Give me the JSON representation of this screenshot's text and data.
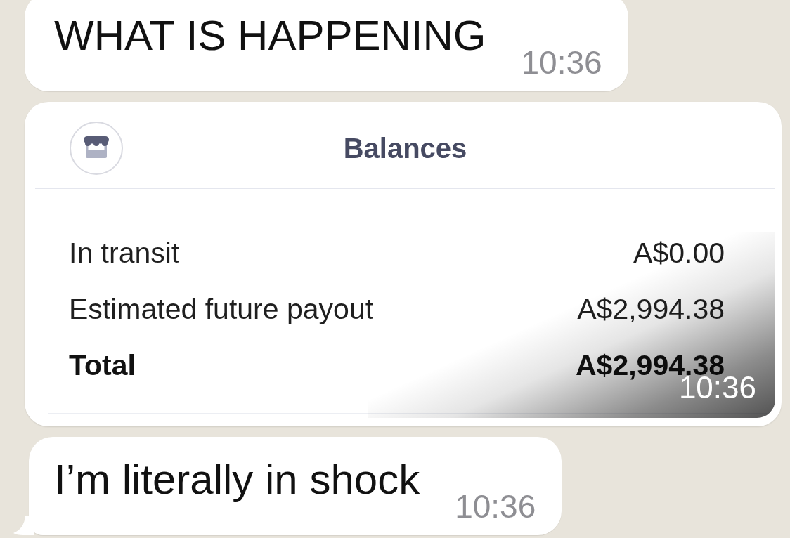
{
  "messages": [
    {
      "kind": "text",
      "text": "WHAT IS HAPPENING",
      "time": "10:36",
      "tail": false
    },
    {
      "kind": "image",
      "card": {
        "title": "Balances",
        "rows": [
          {
            "label": "In transit",
            "amount": "A$0.00",
            "total": false
          },
          {
            "label": "Estimated future payout",
            "amount": "A$2,994.38",
            "total": false
          },
          {
            "label": "Total",
            "amount": "A$2,994.38",
            "total": true
          }
        ]
      },
      "time": "10:36"
    },
    {
      "kind": "text",
      "text": "I’m literally in shock",
      "time": "10:36",
      "tail": true
    }
  ]
}
